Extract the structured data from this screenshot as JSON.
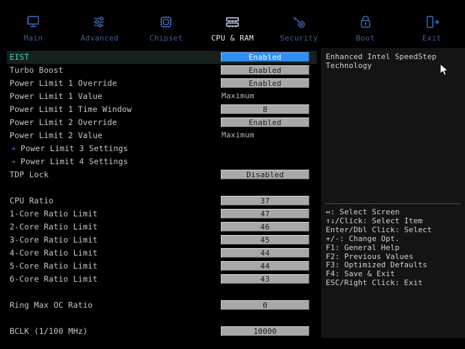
{
  "nav": {
    "items": [
      {
        "label": "Main",
        "icon": "monitor-icon",
        "active": false
      },
      {
        "label": "Advanced",
        "icon": "sliders-icon",
        "active": false
      },
      {
        "label": "Chipset",
        "icon": "cpu-chip-icon",
        "active": false
      },
      {
        "label": "CPU & RAM",
        "icon": "ram-stick-icon",
        "active": true
      },
      {
        "label": "Security",
        "icon": "key-icon",
        "active": false
      },
      {
        "label": "Boot",
        "icon": "lock-icon",
        "active": false
      },
      {
        "label": "Exit",
        "icon": "exit-door-icon",
        "active": false
      }
    ]
  },
  "settings": {
    "rows": [
      {
        "label": "EIST",
        "value": "Enabled",
        "style": "boxed",
        "selected": true,
        "submenu": false,
        "spacer": false
      },
      {
        "label": "Turbo Boost",
        "value": "Enabled",
        "style": "boxed",
        "selected": false,
        "submenu": false,
        "spacer": false
      },
      {
        "label": "Power Limit 1 Override",
        "value": "Enabled",
        "style": "boxed",
        "selected": false,
        "submenu": false,
        "spacer": false
      },
      {
        "label": "Power Limit 1 Value",
        "value": "Maximum",
        "style": "plain",
        "selected": false,
        "submenu": false,
        "spacer": false
      },
      {
        "label": "Power Limit 1 Time Window",
        "value": "8",
        "style": "boxed",
        "selected": false,
        "submenu": false,
        "spacer": false
      },
      {
        "label": "Power Limit 2 Override",
        "value": "Enabled",
        "style": "boxed",
        "selected": false,
        "submenu": false,
        "spacer": false
      },
      {
        "label": "Power Limit 2 Value",
        "value": "Maximum",
        "style": "plain",
        "selected": false,
        "submenu": false,
        "spacer": false
      },
      {
        "label": "Power Limit 3 Settings",
        "value": "",
        "style": "none",
        "selected": false,
        "submenu": true,
        "spacer": false
      },
      {
        "label": "Power Limit 4 Settings",
        "value": "",
        "style": "none",
        "selected": false,
        "submenu": true,
        "spacer": false
      },
      {
        "label": "TDP Lock",
        "value": "Disabled",
        "style": "boxed",
        "selected": false,
        "submenu": false,
        "spacer": false
      },
      {
        "label": "",
        "value": "",
        "style": "none",
        "selected": false,
        "submenu": false,
        "spacer": true
      },
      {
        "label": "CPU Ratio",
        "value": "37",
        "style": "boxed",
        "selected": false,
        "submenu": false,
        "spacer": false
      },
      {
        "label": "1-Core Ratio Limit",
        "value": "47",
        "style": "boxed",
        "selected": false,
        "submenu": false,
        "spacer": false
      },
      {
        "label": "2-Core Ratio Limit",
        "value": "46",
        "style": "boxed",
        "selected": false,
        "submenu": false,
        "spacer": false
      },
      {
        "label": "3-Core Ratio Limit",
        "value": "45",
        "style": "boxed",
        "selected": false,
        "submenu": false,
        "spacer": false
      },
      {
        "label": "4-Core Ratio Limit",
        "value": "44",
        "style": "boxed",
        "selected": false,
        "submenu": false,
        "spacer": false
      },
      {
        "label": "5-Core Ratio Limit",
        "value": "44",
        "style": "boxed",
        "selected": false,
        "submenu": false,
        "spacer": false
      },
      {
        "label": "6-Core Ratio Limit",
        "value": "43",
        "style": "boxed",
        "selected": false,
        "submenu": false,
        "spacer": false
      },
      {
        "label": "",
        "value": "",
        "style": "none",
        "selected": false,
        "submenu": false,
        "spacer": true
      },
      {
        "label": "Ring Max OC Ratio",
        "value": "0",
        "style": "boxed",
        "selected": false,
        "submenu": false,
        "spacer": false
      },
      {
        "label": "",
        "value": "",
        "style": "none",
        "selected": false,
        "submenu": false,
        "spacer": true
      },
      {
        "label": "BCLK  (1/100 MHz)",
        "value": "10000",
        "style": "boxed",
        "selected": false,
        "submenu": false,
        "spacer": false
      }
    ],
    "submenu_arrow_glyph": "➔"
  },
  "help": {
    "description": "Enhanced Intel SpeedStep Technology",
    "key_legend": [
      "↔: Select Screen",
      "↑↓/Click: Select Item",
      "Enter/Dbl Click: Select",
      "+/-: Change Opt.",
      "F1: General Help",
      "F2: Previous Values",
      "F3: Optimized Defaults",
      "F4: Save & Exit",
      "ESC/Right Click: Exit"
    ]
  },
  "colors": {
    "background": "#000000",
    "nav_label": "#3f5f96",
    "nav_label_active": "#e8e8e8",
    "nav_icon": "#3f6fc0",
    "selected_row_bg": "#16201e",
    "selected_label": "#3fd6c4",
    "selected_value_bg": "#2f8ff5",
    "value_box_bg": "#a8a8a8",
    "help_panel_bg": "#141414",
    "submenu_arrow": "#4a6fd0",
    "text": "#c9c9c9"
  }
}
